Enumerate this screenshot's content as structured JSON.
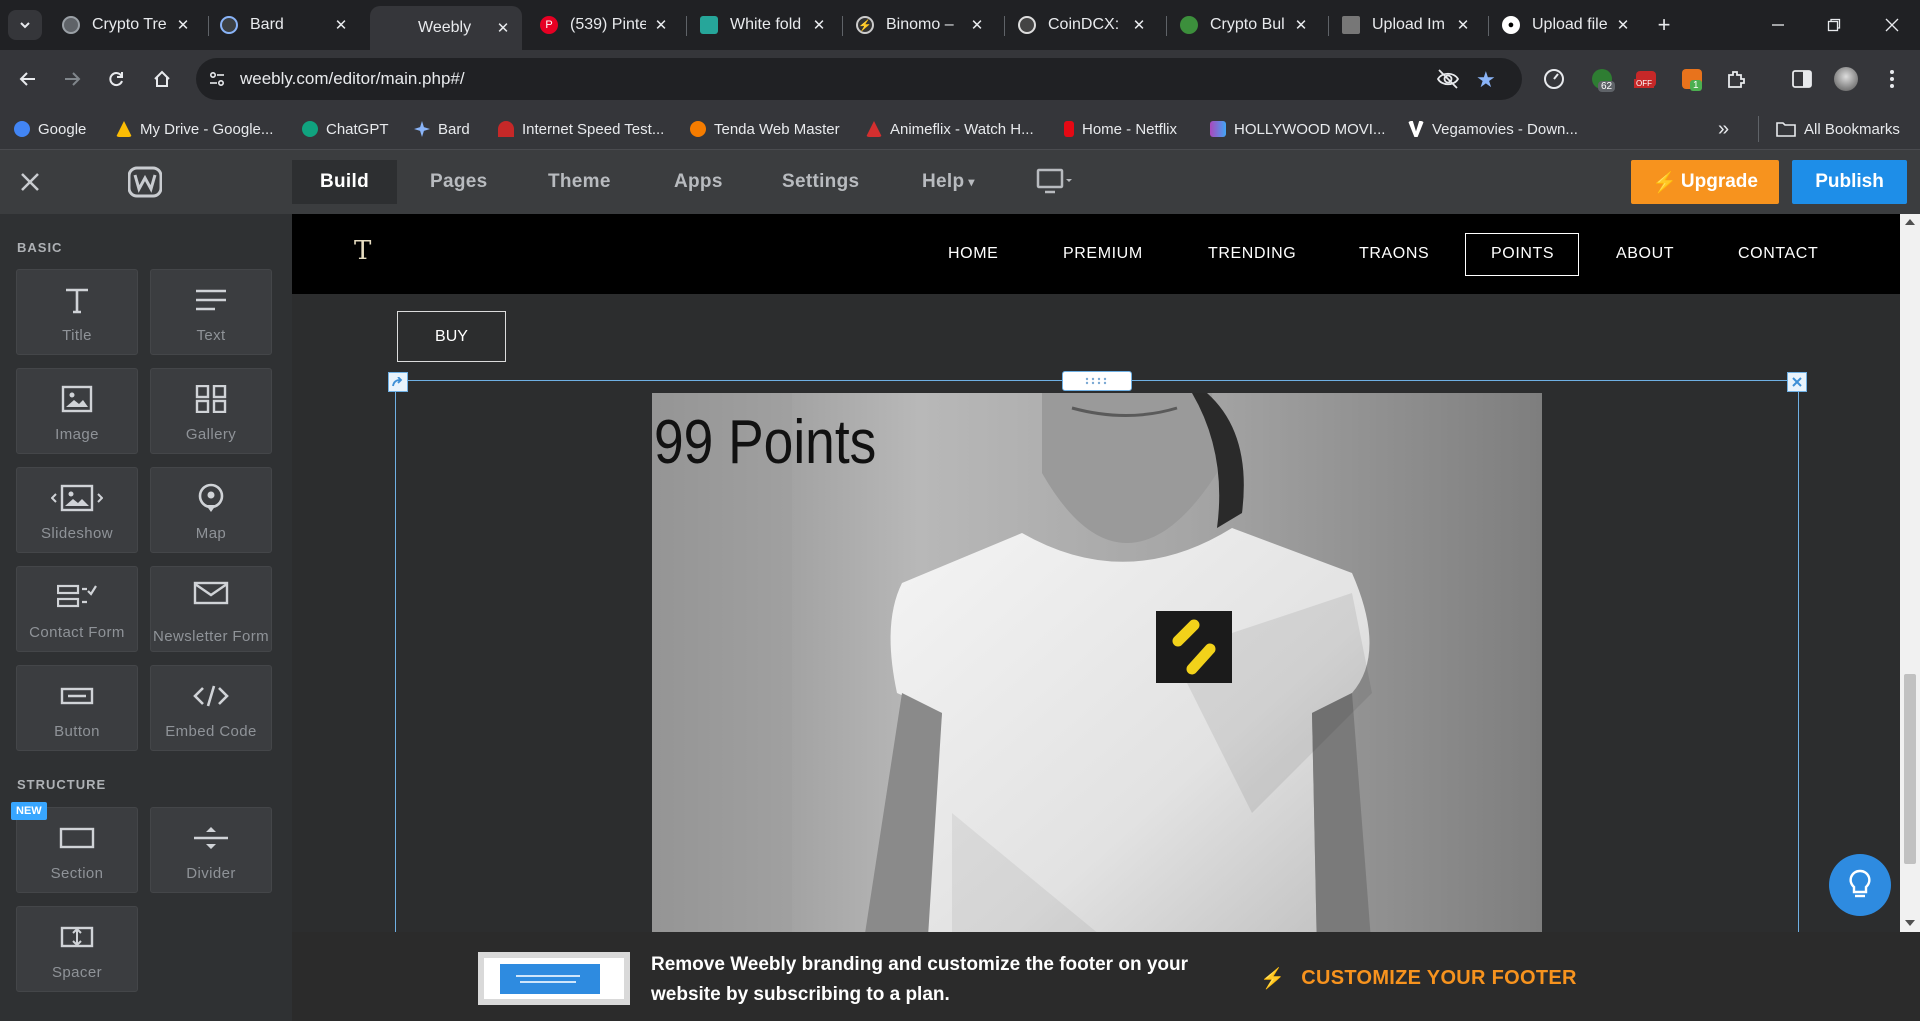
{
  "browser": {
    "tabs": [
      {
        "title": "Crypto Tre",
        "color": "#5f6368"
      },
      {
        "title": "Bard",
        "color": "#4285f4"
      },
      {
        "title": "Weebly",
        "color": "",
        "active": true
      },
      {
        "title": "(539) Pinte",
        "color": "#e60023"
      },
      {
        "title": "White fold",
        "color": "#26a69a"
      },
      {
        "title": "Binomo – ",
        "color": "#444"
      },
      {
        "title": "CoinDCX: C",
        "color": "#555"
      },
      {
        "title": "Crypto Bul",
        "color": "#3c8f3c"
      },
      {
        "title": "Upload Im",
        "color": "#666"
      },
      {
        "title": "Upload file",
        "color": "#fff"
      }
    ],
    "new_tab": "+",
    "url": "weebly.com/editor/main.php#/",
    "bookmarks": [
      {
        "label": "Google",
        "color": "#4285f4"
      },
      {
        "label": "My Drive - Google...",
        "color": "#fbbc04"
      },
      {
        "label": "ChatGPT",
        "color": "#10a37f"
      },
      {
        "label": "Bard",
        "color": "#8ab4f8"
      },
      {
        "label": "Internet Speed Test...",
        "color": "#c62828"
      },
      {
        "label": "Tenda Web Master",
        "color": "#f57c00"
      },
      {
        "label": "Animeflix - Watch H...",
        "color": "#d32f2f"
      },
      {
        "label": "Home - Netflix",
        "color": "#e50914"
      },
      {
        "label": "HOLLYWOOD MOVI...",
        "color": "#ab47bc"
      },
      {
        "label": "Vegamovies - Down...",
        "color": "#e53935"
      }
    ],
    "bookmarks_more": "»",
    "all_bookmarks": "All Bookmarks",
    "ext_badge_1": "62",
    "ext_badge_2": "OFF",
    "ext_badge_3": "1"
  },
  "editor": {
    "logo": "W",
    "nav": [
      "Build",
      "Pages",
      "Theme",
      "Apps",
      "Settings",
      "Help"
    ],
    "upgrade": "Upgrade",
    "publish": "Publish"
  },
  "sidebar": {
    "basic_heading": "BASIC",
    "structure_heading": "STRUCTURE",
    "new_badge": "NEW",
    "basic": [
      {
        "label": "Title",
        "icon": "title-icon"
      },
      {
        "label": "Text",
        "icon": "text-icon"
      },
      {
        "label": "Image",
        "icon": "image-icon"
      },
      {
        "label": "Gallery",
        "icon": "gallery-icon"
      },
      {
        "label": "Slideshow",
        "icon": "slideshow-icon"
      },
      {
        "label": "Map",
        "icon": "map-icon"
      },
      {
        "label": "Contact Form",
        "icon": "contact-form-icon"
      },
      {
        "label": "Newsletter Form",
        "icon": "newsletter-icon"
      },
      {
        "label": "Button",
        "icon": "button-icon"
      },
      {
        "label": "Embed Code",
        "icon": "embed-code-icon"
      }
    ],
    "structure": [
      {
        "label": "Section",
        "icon": "section-icon"
      },
      {
        "label": "Divider",
        "icon": "divider-icon"
      },
      {
        "label": "Spacer",
        "icon": "spacer-icon"
      }
    ]
  },
  "site": {
    "logo": "T",
    "nav": [
      "HOME",
      "PREMIUM",
      "TRENDING",
      "TRAONS",
      "POINTS",
      "ABOUT",
      "CONTACT"
    ],
    "active_nav": "POINTS",
    "buy_button": "BUY",
    "image_caption": "99 Points"
  },
  "footer": {
    "message": "Remove Weebly branding and customize the footer on your website by subscribing to a plan.",
    "cta": "CUSTOMIZE YOUR FOOTER"
  }
}
